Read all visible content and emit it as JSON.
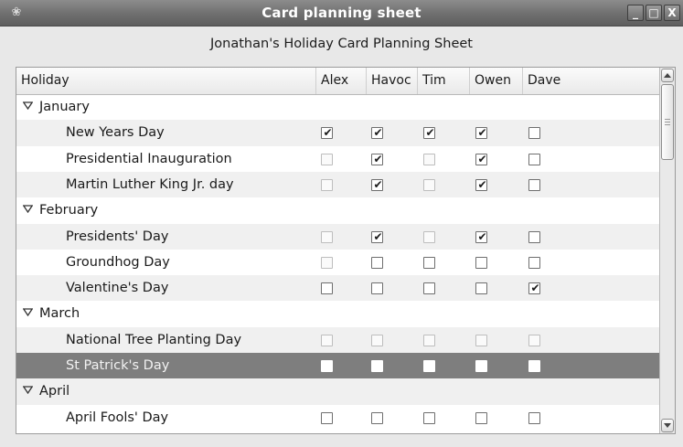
{
  "window": {
    "title": "Card planning sheet",
    "buttons": {
      "minimize": "_",
      "maximize": "□",
      "close": "X"
    }
  },
  "heading": "Jonathan's Holiday Card Planning Sheet",
  "columns": [
    "Holiday",
    "Alex",
    "Havoc",
    "Tim",
    "Owen",
    "Dave"
  ],
  "rows": [
    {
      "type": "group",
      "label": "January"
    },
    {
      "type": "item",
      "label": "New Years Day",
      "checks": [
        true,
        true,
        true,
        true,
        false
      ],
      "inactive": [
        false,
        false,
        false,
        false,
        false
      ]
    },
    {
      "type": "item",
      "label": "Presidential Inauguration",
      "checks": [
        false,
        true,
        false,
        true,
        false
      ],
      "inactive": [
        true,
        false,
        true,
        false,
        false
      ]
    },
    {
      "type": "item",
      "label": "Martin Luther King Jr. day",
      "checks": [
        false,
        true,
        false,
        true,
        false
      ],
      "inactive": [
        true,
        false,
        true,
        false,
        false
      ]
    },
    {
      "type": "group",
      "label": "February"
    },
    {
      "type": "item",
      "label": "Presidents' Day",
      "checks": [
        false,
        true,
        false,
        true,
        false
      ],
      "inactive": [
        true,
        false,
        true,
        false,
        false
      ]
    },
    {
      "type": "item",
      "label": "Groundhog Day",
      "checks": [
        false,
        false,
        false,
        false,
        false
      ],
      "inactive": [
        true,
        false,
        false,
        false,
        false
      ]
    },
    {
      "type": "item",
      "label": "Valentine's Day",
      "checks": [
        false,
        false,
        false,
        false,
        true
      ],
      "inactive": [
        false,
        false,
        false,
        false,
        false
      ]
    },
    {
      "type": "group",
      "label": "March"
    },
    {
      "type": "item",
      "label": "National Tree Planting Day",
      "checks": [
        false,
        false,
        false,
        false,
        false
      ],
      "inactive": [
        true,
        true,
        true,
        true,
        true
      ]
    },
    {
      "type": "item",
      "label": "St Patrick's Day",
      "checks": [
        false,
        false,
        false,
        false,
        false
      ],
      "inactive": [
        false,
        false,
        false,
        false,
        false
      ],
      "selected": true
    },
    {
      "type": "group",
      "label": "April"
    },
    {
      "type": "item",
      "label": "April Fools' Day",
      "checks": [
        false,
        false,
        false,
        false,
        false
      ],
      "inactive": [
        false,
        false,
        false,
        false,
        false
      ]
    }
  ],
  "colors": {
    "selection": "#7e7e7e",
    "titlebar": "#6f6f6f",
    "altRow": "#f0f0f0"
  },
  "icons": {
    "expander": "triangle-down-icon",
    "app": "app-icon",
    "check": "✔"
  }
}
